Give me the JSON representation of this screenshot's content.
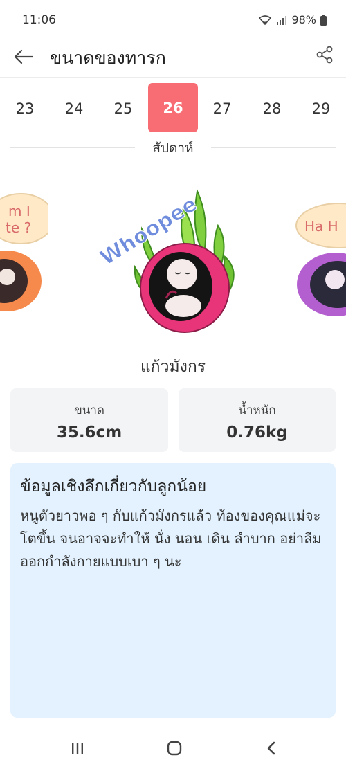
{
  "status_bar": {
    "time": "11:06",
    "battery": "98%"
  },
  "app_bar": {
    "title": "ขนาดของทารก"
  },
  "weeks": {
    "items": [
      "23",
      "24",
      "25",
      "26",
      "27",
      "28",
      "29"
    ],
    "selected": "26",
    "label": "สัปดาห์"
  },
  "carousel": {
    "main_sticker_text": "Whoopee",
    "left_bubble_text": [
      "m I",
      "te ?"
    ],
    "right_bubble_text": "Ha H"
  },
  "fruit": {
    "name": "แก้วมังกร"
  },
  "stats": {
    "size_label": "ขนาด",
    "size_value": "35.6cm",
    "weight_label": "น้ำหนัก",
    "weight_value": "0.76kg"
  },
  "insight": {
    "title": "ข้อมูลเชิงลึกเกี่ยวกับลูกน้อย",
    "body": "หนูตัวยาวพอ ๆ กับแก้วมังกรแล้ว ท้องของคุณแม่จะโตขึ้น จนอาจจะทำให้ นั่ง นอน เดิน ลำบาก อย่าลืมออกกำลังกายแบบเบา ๆ นะ"
  },
  "colors": {
    "accent": "#f76d73",
    "insight_bg": "#e3f2fe",
    "card_bg": "#f3f4f6"
  }
}
